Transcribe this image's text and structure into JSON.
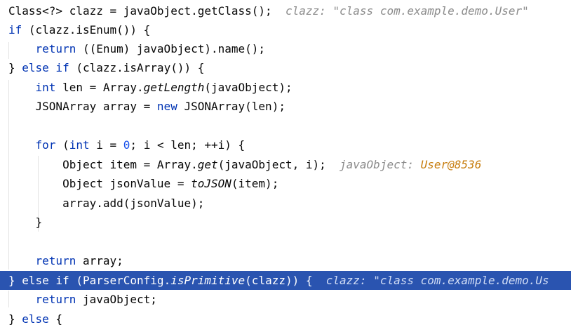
{
  "lines": [
    {
      "parts": [
        "Class<?> clazz = javaObject.getClass();"
      ],
      "hint": "clazz: \"class com.example.demo.User\""
    },
    {
      "parts": [
        "if",
        " (clazz.isEnum()) {"
      ]
    },
    {
      "parts": [
        "return",
        " ((Enum) javaObject).name();"
      ]
    },
    {
      "parts": [
        "} ",
        "else if",
        " (clazz.isArray()) {"
      ]
    },
    {
      "parts": [
        "int",
        " len = Array.",
        "getLength",
        "(javaObject);"
      ]
    },
    {
      "parts": [
        "JSONArray array = ",
        "new",
        " JSONArray(len);"
      ]
    },
    {
      "parts": []
    },
    {
      "parts": [
        "for",
        " (",
        "int",
        " i = ",
        "0",
        "; i < len; ++i) {"
      ]
    },
    {
      "parts": [
        "Object item = Array.",
        "get",
        "(javaObject, i);"
      ],
      "hint_label": "javaObject:",
      "hint_value": "User@8536"
    },
    {
      "parts": [
        "Object jsonValue = ",
        "toJSON",
        "(item);"
      ]
    },
    {
      "parts": [
        "array.add(jsonValue);"
      ]
    },
    {
      "parts": [
        "}"
      ]
    },
    {
      "parts": []
    },
    {
      "parts": [
        "return",
        " array;"
      ]
    },
    {
      "parts": [
        "} ",
        "else if",
        " (ParserConfig.",
        "isPrimitive",
        "(clazz)) {"
      ],
      "hint": "clazz: \"class com.example.demo.Us"
    },
    {
      "parts": [
        "return",
        " javaObject;"
      ]
    },
    {
      "parts": [
        "} ",
        "else",
        " {"
      ]
    }
  ],
  "colors": {
    "keyword": "#0033b3",
    "number": "#1750eb",
    "hint": "#8c8c8c",
    "hint_value": "#c77d0e",
    "selection": "#2a54b0",
    "background": "#ffffff"
  }
}
